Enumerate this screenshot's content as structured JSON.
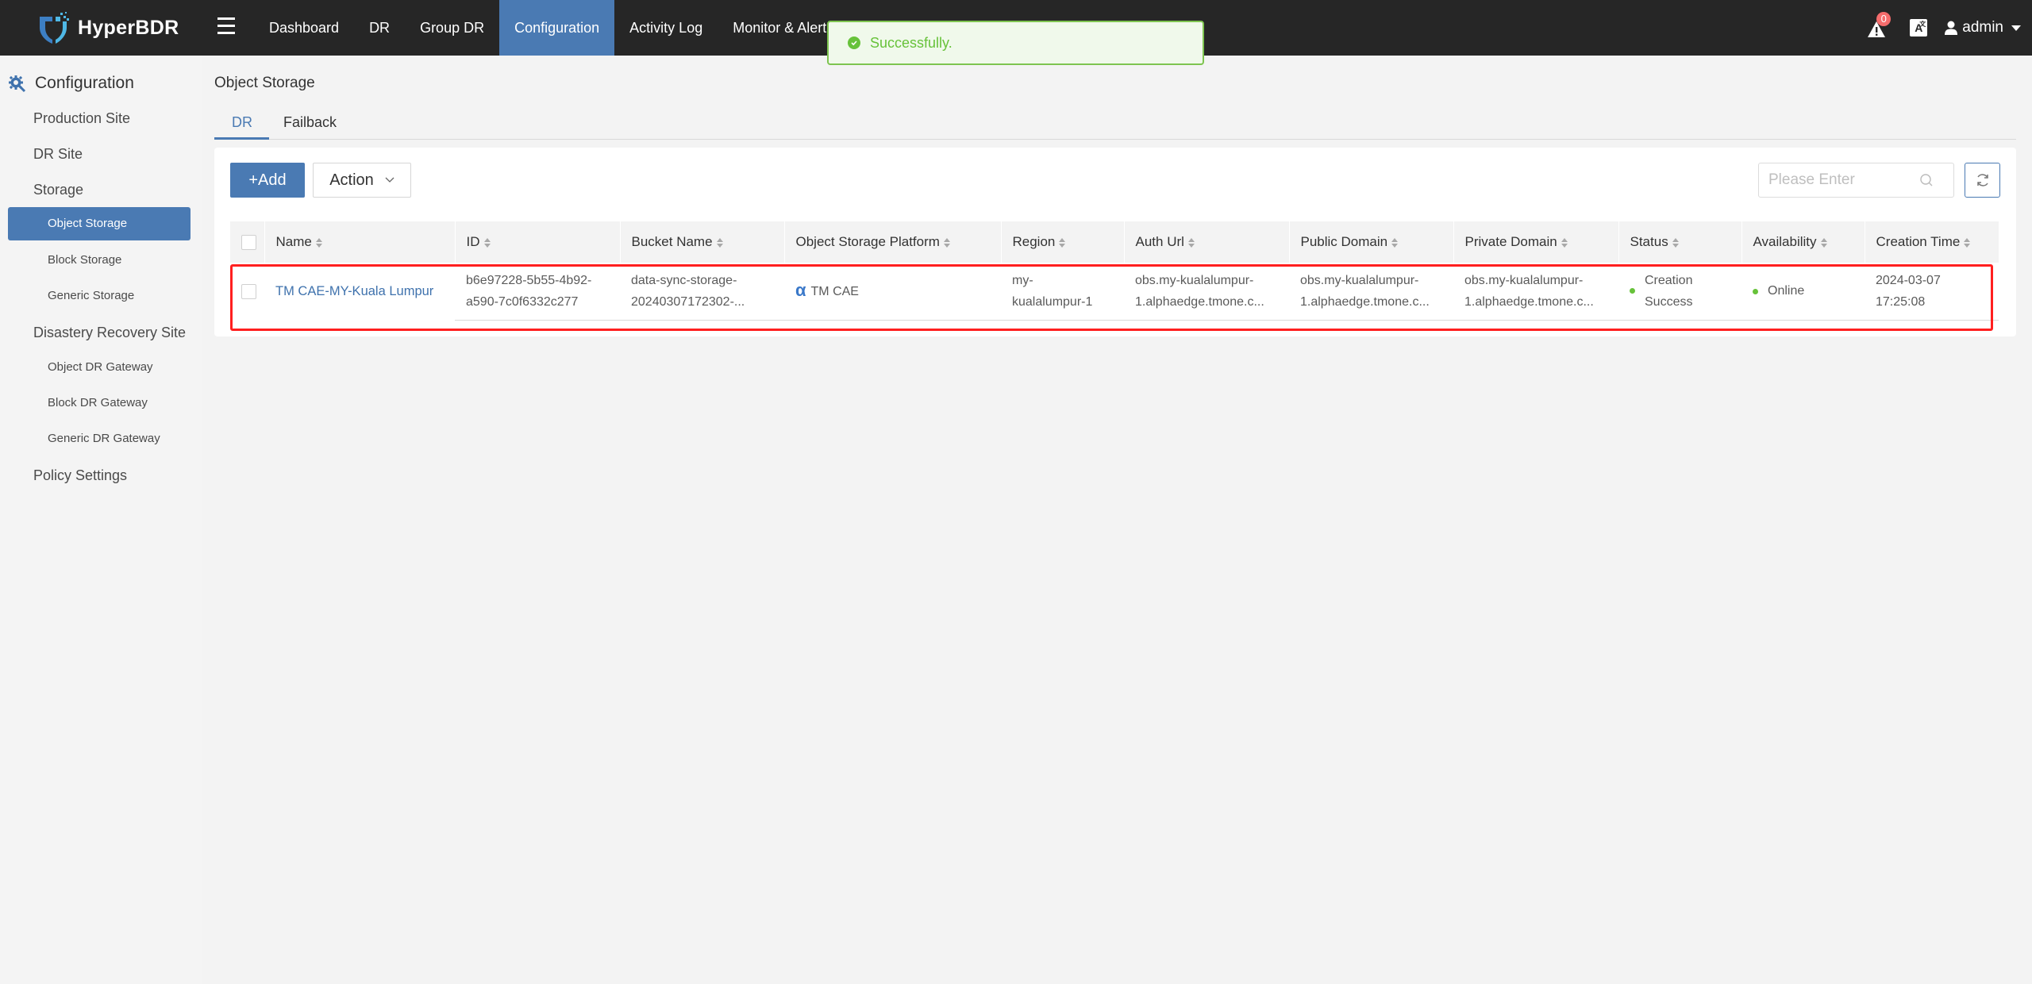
{
  "app": {
    "name": "HyperBDR"
  },
  "nav": {
    "items": [
      {
        "label": "Dashboard",
        "active": false
      },
      {
        "label": "DR",
        "active": false
      },
      {
        "label": "Group DR",
        "active": false
      },
      {
        "label": "Configuration",
        "active": true
      },
      {
        "label": "Activity Log",
        "active": false
      },
      {
        "label": "Monitor & Alert",
        "active": false
      }
    ]
  },
  "header_right": {
    "alert_count": "0",
    "lang_icon_glyph": "A",
    "lang_icon_sup": "文",
    "user": "admin"
  },
  "toast": {
    "message": "Successfully.",
    "type": "success",
    "color": "#67c23a"
  },
  "sidebar": {
    "title": "Configuration",
    "items": [
      {
        "label": "Production Site",
        "level": 1
      },
      {
        "label": "DR Site",
        "level": 1
      },
      {
        "label": "Storage",
        "level": 1
      },
      {
        "label": "Object Storage",
        "level": 2,
        "active": true
      },
      {
        "label": "Block Storage",
        "level": 2
      },
      {
        "label": "Generic Storage",
        "level": 2
      },
      {
        "label": "Disastery Recovery Site",
        "level": 1
      },
      {
        "label": "Object DR Gateway",
        "level": 2
      },
      {
        "label": "Block DR Gateway",
        "level": 2
      },
      {
        "label": "Generic DR Gateway",
        "level": 2
      },
      {
        "label": "Policy Settings",
        "level": 1
      }
    ]
  },
  "page": {
    "title": "Object Storage",
    "tabs": [
      {
        "label": "DR",
        "active": true
      },
      {
        "label": "Failback",
        "active": false
      }
    ]
  },
  "toolbar": {
    "add_label": "+Add",
    "action_label": "Action",
    "search_placeholder": "Please Enter",
    "search_value": ""
  },
  "table": {
    "columns": [
      "Name",
      "ID",
      "Bucket Name",
      "Object Storage Platform",
      "Region",
      "Auth Url",
      "Public Domain",
      "Private Domain",
      "Status",
      "Availability",
      "Creation Time"
    ],
    "rows": [
      {
        "name": "TM CAE-MY-Kuala Lumpur",
        "id_line1": "b6e97228-5b55-4b92-",
        "id_line2": "a590-7c0f6332c277",
        "bucket_line1": "data-sync-storage-",
        "bucket_line2": "20240307172302-...",
        "platform_icon": "α",
        "platform": "TM CAE",
        "region_line1": "my-",
        "region_line2": "kualalumpur-1",
        "auth_url_line1": "obs.my-kualalumpur-",
        "auth_url_line2": "1.alphaedge.tmone.c...",
        "public_domain_line1": "obs.my-kualalumpur-",
        "public_domain_line2": "1.alphaedge.tmone.c...",
        "private_domain_line1": "obs.my-kualalumpur-",
        "private_domain_line2": "1.alphaedge.tmone.c...",
        "status_line1": "Creation",
        "status_line2": "Success",
        "availability": "Online",
        "created_line1": "2024-03-07",
        "created_line2": "17:25:08"
      }
    ]
  },
  "colors": {
    "header_bg": "#262626",
    "accent": "#4a7ab3",
    "success": "#67c23a",
    "highlight": "#ff1f1f"
  }
}
